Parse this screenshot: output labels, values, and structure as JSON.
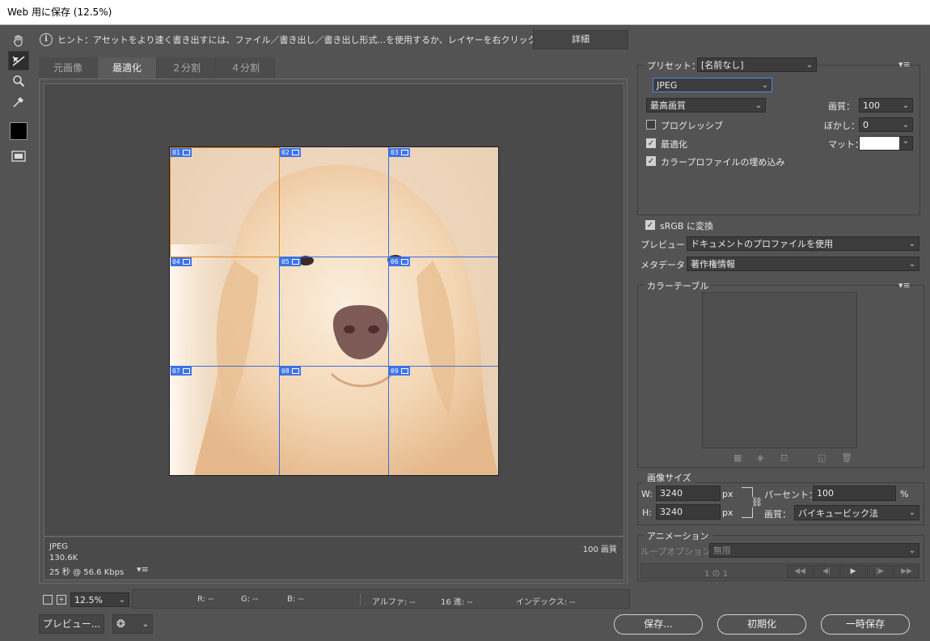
{
  "window": {
    "title": "Web 用に保存 (12.5%)"
  },
  "hint": {
    "text": "ヒント：アセットをより速く書き出すには、ファイル／書き出し／書き出し形式...を使用するか、レイヤーを右クリックして使用。",
    "details_button": "詳細"
  },
  "tools": [
    {
      "name": "hand-tool",
      "glyph": "✋"
    },
    {
      "name": "slice-select-tool",
      "glyph": "⬊"
    },
    {
      "name": "zoom-tool",
      "glyph": "🔍"
    },
    {
      "name": "eyedropper-tool",
      "glyph": "✒"
    }
  ],
  "tabs": [
    "元画像",
    "最適化",
    "２分割",
    "４分割"
  ],
  "active_tab": 1,
  "slices": [
    "01",
    "02",
    "03",
    "04",
    "05",
    "06",
    "07",
    "08",
    "09"
  ],
  "image_info": {
    "format": "JPEG",
    "size": "130.6K",
    "time": "25 秒 @ 56.6 Kbps",
    "quality_label": "100 画質"
  },
  "zoom": {
    "value": "12.5%"
  },
  "status": {
    "r": "R: --",
    "g": "G: --",
    "b": "B: --",
    "alpha": "アルファ: --",
    "hex": "16 進: --",
    "index": "インデックス: --"
  },
  "bottom_buttons": {
    "preview": "プレビュー...",
    "save": "保存...",
    "reset": "初期化",
    "remember": "一時保存"
  },
  "settings": {
    "preset_label": "プリセット：",
    "preset_value": "[名前なし]",
    "format": "JPEG",
    "quality_preset": "最高画質",
    "quality_label": "画質：",
    "quality_value": "100",
    "progressive": "プログレッシブ",
    "progressive_checked": false,
    "blur_label": "ぼかし：",
    "blur_value": "0",
    "optimized": "最適化",
    "optimized_checked": true,
    "matte_label": "マット：",
    "embed_profile": "カラープロファイルの埋め込み",
    "embed_profile_checked": true,
    "srgb": "sRGB に変換",
    "srgb_checked": true,
    "preview_label": "プレビュー：",
    "preview_value": "ドキュメントのプロファイルを使用",
    "metadata_label": "メタデータ：",
    "metadata_value": "著作権情報"
  },
  "color_table": {
    "title": "カラーテーブル"
  },
  "image_size": {
    "title": "画像サイズ",
    "w_label": "W:",
    "w_value": "3240",
    "h_label": "H:",
    "h_value": "3240",
    "unit": "px",
    "percent_label": "パーセント：",
    "percent_value": "100",
    "percent_unit": "%",
    "quality_label": "画質：",
    "quality_value": "バイキュービック法"
  },
  "animation": {
    "title": "アニメーション",
    "loop_label": "ループオプション：",
    "loop_value": "無限",
    "frame": "1 の 1"
  },
  "colors": {
    "slice_accent": "#3f73e6",
    "selected_slice": "#e08a1e"
  }
}
